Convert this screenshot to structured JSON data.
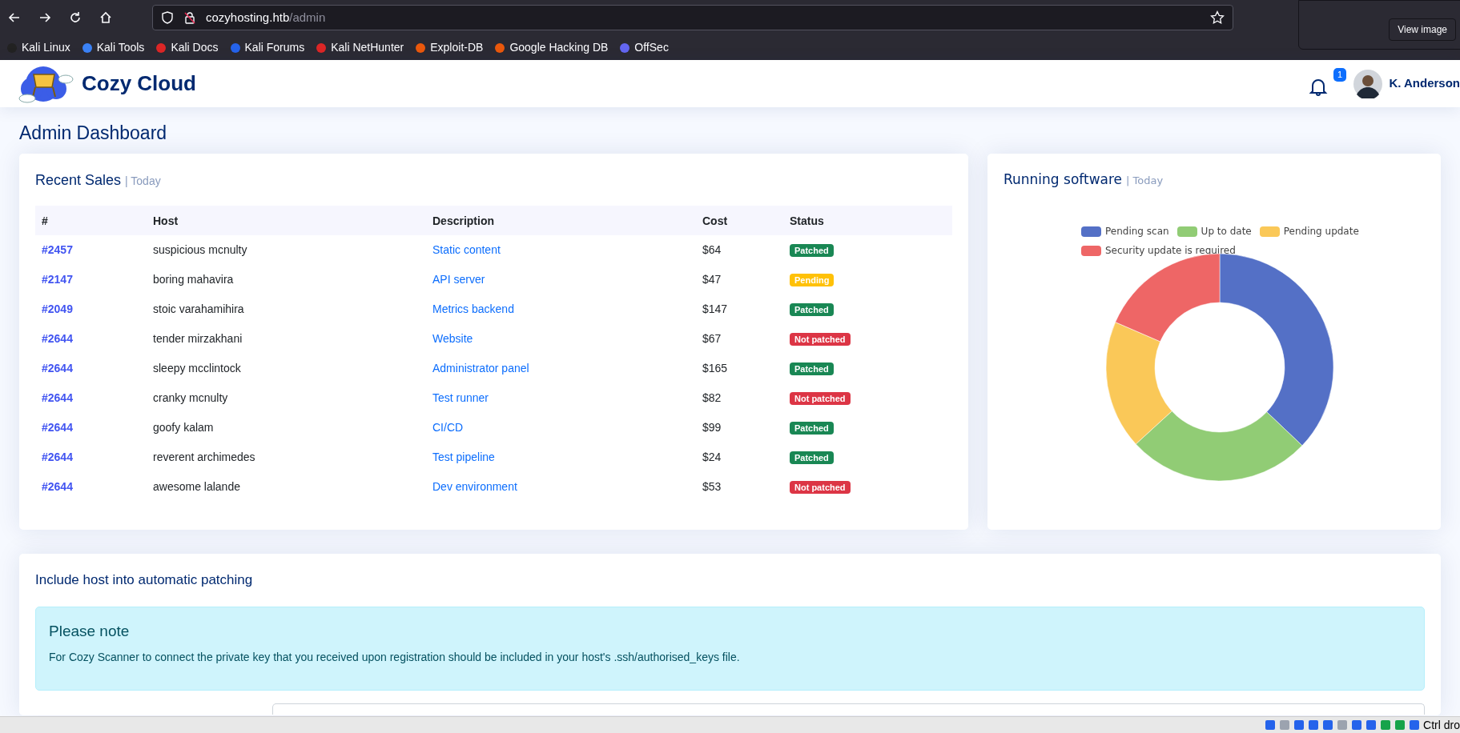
{
  "browser": {
    "url": {
      "host": "cozyhosting.htb",
      "path": "/admin"
    },
    "bookmarks": [
      {
        "label": "Kali Linux",
        "color": "#222222"
      },
      {
        "label": "Kali Tools",
        "color": "#3b82f6"
      },
      {
        "label": "Kali Docs",
        "color": "#dc2626"
      },
      {
        "label": "Kali Forums",
        "color": "#2563eb"
      },
      {
        "label": "Kali NetHunter",
        "color": "#dc2626"
      },
      {
        "label": "Exploit-DB",
        "color": "#ea580c"
      },
      {
        "label": "Google Hacking DB",
        "color": "#ea580c"
      },
      {
        "label": "OffSec",
        "color": "#6366f1"
      }
    ],
    "notification": {
      "button": "View image"
    }
  },
  "header": {
    "brand": "Cozy Cloud",
    "notification_count": "1",
    "user": "K. Anderson"
  },
  "page_title": "Admin Dashboard",
  "sales": {
    "title": "Recent Sales",
    "subtitle": "| Today",
    "columns": [
      "#",
      "Host",
      "Description",
      "Cost",
      "Status"
    ],
    "rows": [
      {
        "id": "#2457",
        "host": "suspicious mcnulty",
        "description": "Static content",
        "cost": "$64",
        "status": "Patched",
        "kind": "patched"
      },
      {
        "id": "#2147",
        "host": "boring mahavira",
        "description": "API server",
        "cost": "$47",
        "status": "Pending",
        "kind": "pending"
      },
      {
        "id": "#2049",
        "host": "stoic varahamihira",
        "description": "Metrics backend",
        "cost": "$147",
        "status": "Patched",
        "kind": "patched"
      },
      {
        "id": "#2644",
        "host": "tender mirzakhani",
        "description": "Website",
        "cost": "$67",
        "status": "Not patched",
        "kind": "not_patched"
      },
      {
        "id": "#2644",
        "host": "sleepy mcclintock",
        "description": "Administrator panel",
        "cost": "$165",
        "status": "Patched",
        "kind": "patched"
      },
      {
        "id": "#2644",
        "host": "cranky mcnulty",
        "description": "Test runner",
        "cost": "$82",
        "status": "Not patched",
        "kind": "not_patched"
      },
      {
        "id": "#2644",
        "host": "goofy kalam",
        "description": "CI/CD",
        "cost": "$99",
        "status": "Patched",
        "kind": "patched"
      },
      {
        "id": "#2644",
        "host": "reverent archimedes",
        "description": "Test pipeline",
        "cost": "$24",
        "status": "Patched",
        "kind": "patched"
      },
      {
        "id": "#2644",
        "host": "awesome lalande",
        "description": "Dev environment",
        "cost": "$53",
        "status": "Not patched",
        "kind": "not_patched"
      }
    ]
  },
  "software": {
    "title": "Running software",
    "subtitle": "| Today",
    "legend": [
      {
        "label": "Pending scan",
        "color": "#5470c6"
      },
      {
        "label": "Up to date",
        "color": "#91cc75"
      },
      {
        "label": "Pending update",
        "color": "#fac858"
      },
      {
        "label": "Security update is required",
        "color": "#ee6666"
      }
    ]
  },
  "patching": {
    "title": "Include host into automatic patching",
    "note_title": "Please note",
    "note_text": "For Cozy Scanner to connect the private key that you received upon registration should be included in your host's .ssh/authorised_keys file."
  },
  "taskbar": {
    "text": "Ctrl dro"
  }
}
